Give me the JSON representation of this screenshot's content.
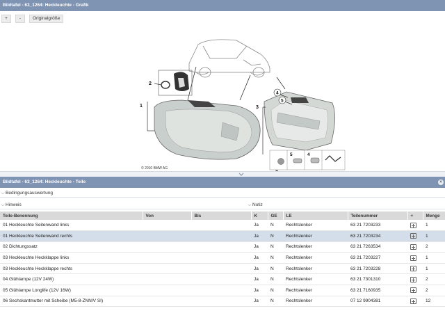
{
  "graphic_panel": {
    "title": "Bildtafel - 63_1264: Heckleuchte - Grafik",
    "toolbar": {
      "zoom_in": "+",
      "zoom_out": "-",
      "original_size": "Originalgröße"
    },
    "diagram": {
      "labels": [
        "1",
        "2",
        "3",
        "4",
        "5",
        "6",
        "4",
        "5"
      ],
      "copyright": "© 2010 BMW AG",
      "image_number": "231443"
    }
  },
  "parts_panel": {
    "title": "Bildtafel - 63_1264: Heckleuchte - Teile",
    "close": "×",
    "sections": {
      "conditions": "Bedingungsauswertung",
      "hint": "Hinweis",
      "note": "Notiz"
    },
    "columns": [
      "Teile-Benennung",
      "Von",
      "Bis",
      "K",
      "GE",
      "LE",
      "Teilenummer",
      "+",
      "Menge"
    ],
    "rows": [
      {
        "name": "01 Heckleuchte Seitenwand links",
        "von": "",
        "bis": "",
        "k": "Ja",
        "ge": "N",
        "le": "Rechtslenker",
        "number": "63 21 7203233",
        "qty": "1",
        "selected": false
      },
      {
        "name": "01 Heckleuchte Seitenwand rechts",
        "von": "",
        "bis": "",
        "k": "Ja",
        "ge": "N",
        "le": "Rechtslenker",
        "number": "63 21 7203234",
        "qty": "1",
        "selected": true
      },
      {
        "name": "02 Dichtungssatz",
        "von": "",
        "bis": "",
        "k": "Ja",
        "ge": "N",
        "le": "Rechtslenker",
        "number": "63 21 7263534",
        "qty": "2",
        "selected": false
      },
      {
        "name": "03 Heckleuchte Heckklappe links",
        "von": "",
        "bis": "",
        "k": "Ja",
        "ge": "N",
        "le": "Rechtslenker",
        "number": "63 21 7203227",
        "qty": "1",
        "selected": false
      },
      {
        "name": "03 Heckleuchte Heckklappe rechts",
        "von": "",
        "bis": "",
        "k": "Ja",
        "ge": "N",
        "le": "Rechtslenker",
        "number": "63 21 7203228",
        "qty": "1",
        "selected": false
      },
      {
        "name": "04 Glühlampe (12V 24W)",
        "von": "",
        "bis": "",
        "k": "Ja",
        "ge": "N",
        "le": "Rechtslenker",
        "number": "63 21 7301310",
        "qty": "2",
        "selected": false
      },
      {
        "name": "05 Glühlampe Longlife (12V 16W)",
        "von": "",
        "bis": "",
        "k": "Ja",
        "ge": "N",
        "le": "Rechtslenker",
        "number": "63 21 7160935",
        "qty": "2",
        "selected": false
      },
      {
        "name": "06 Sechskantmutter mit Scheibe (M5-8-ZNNIV SI)",
        "von": "",
        "bis": "",
        "k": "Ja",
        "ge": "N",
        "le": "Rechtslenker",
        "number": "07 12 9904381",
        "qty": "12",
        "selected": false
      }
    ]
  }
}
